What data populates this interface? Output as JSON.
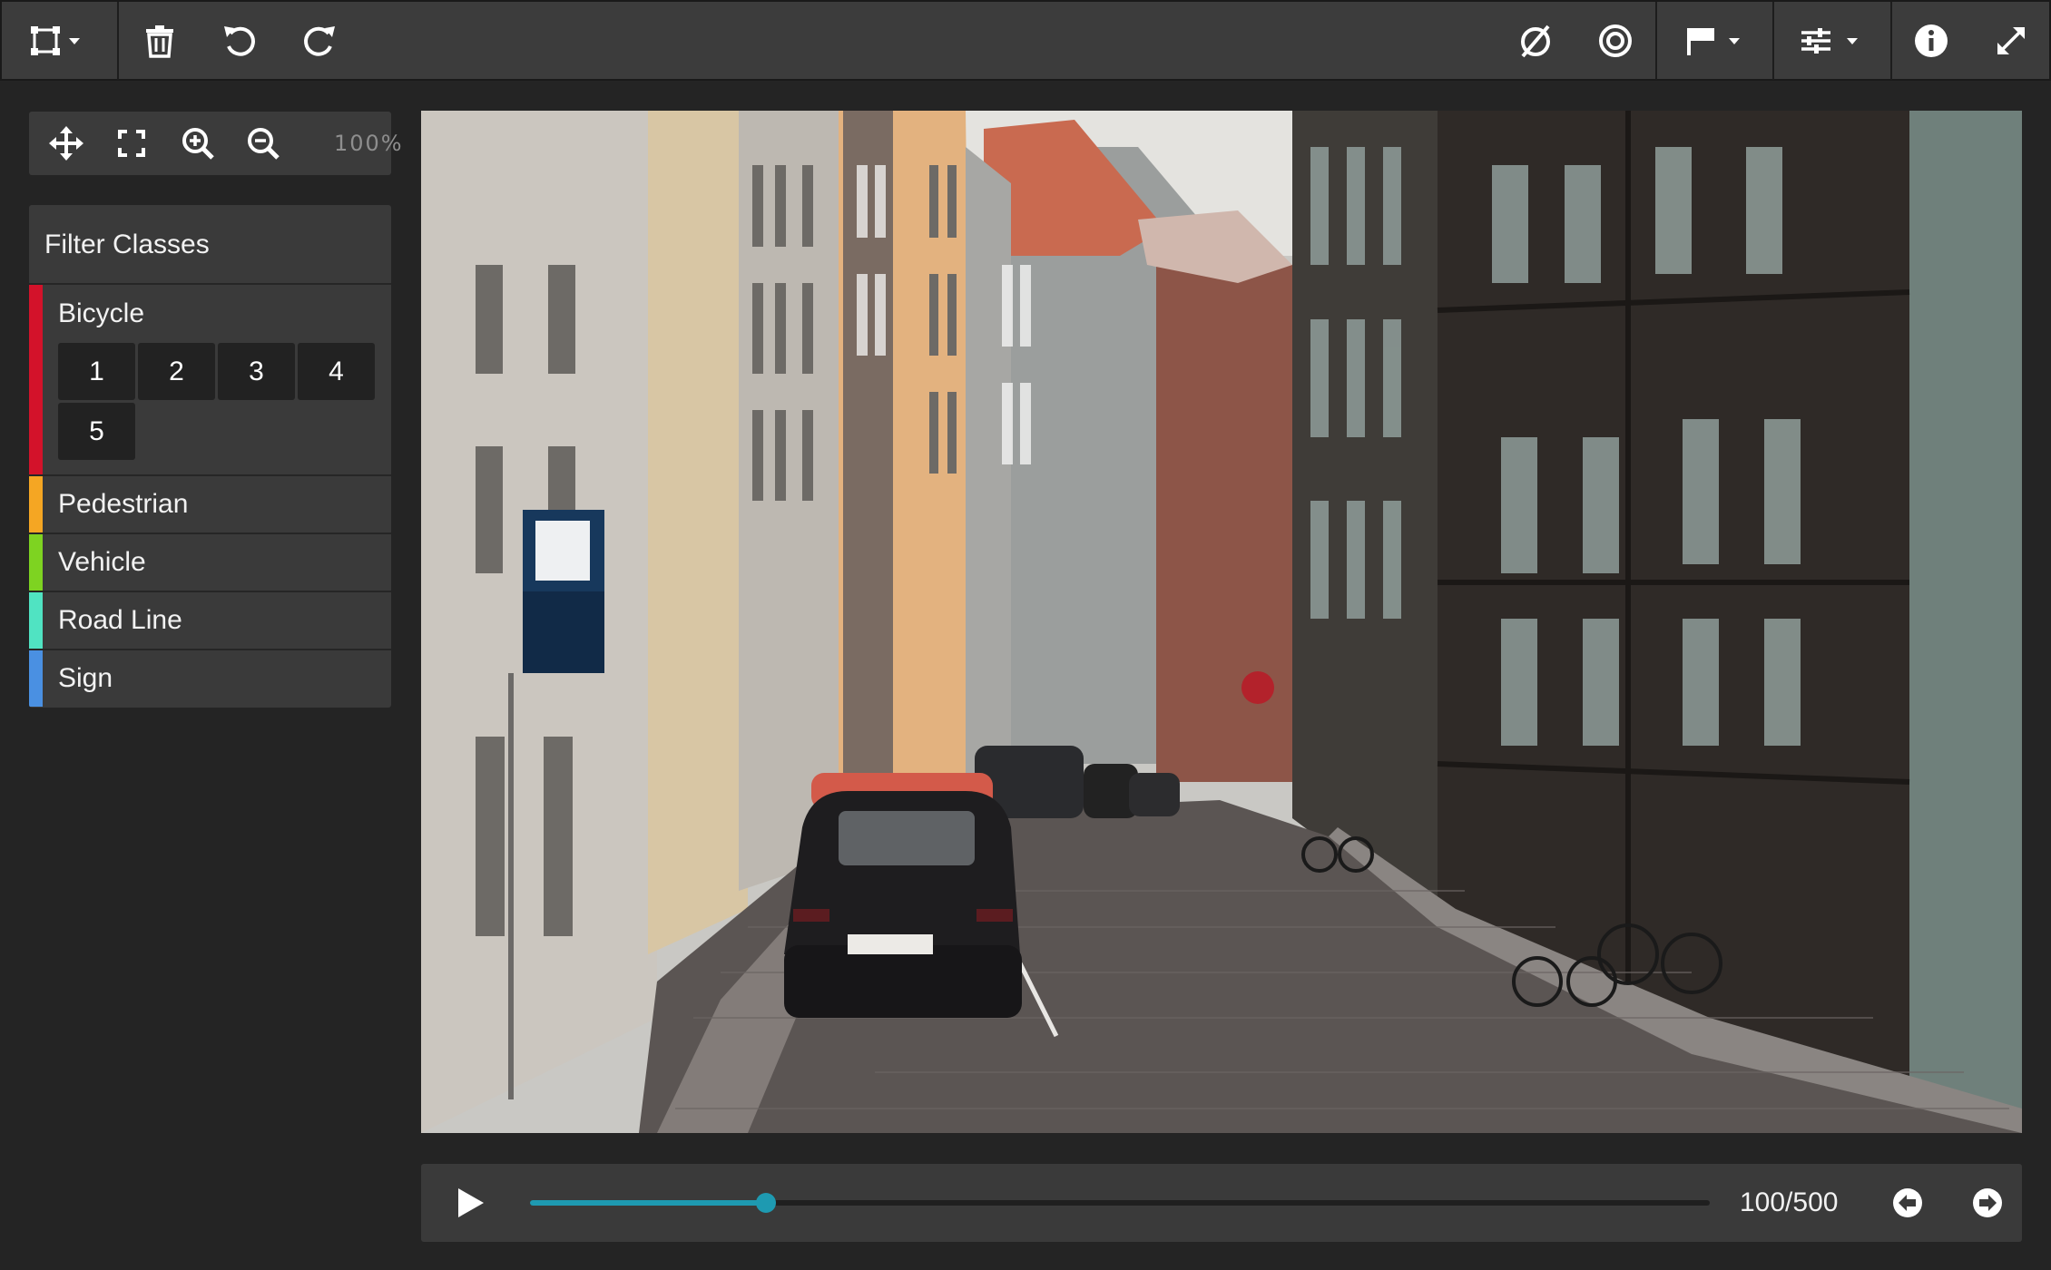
{
  "toolbar": {
    "left_tools": [
      {
        "icon": "bounding-box-icon",
        "dropdown": true
      },
      {
        "icon": "trash-icon"
      },
      {
        "icon": "undo-icon"
      },
      {
        "icon": "redo-icon"
      }
    ],
    "right_tools": [
      {
        "icon": "hide-annotations-icon"
      },
      {
        "icon": "target-icon"
      },
      {
        "icon": "flag-icon",
        "dropdown": true
      },
      {
        "icon": "settings-sliders-icon",
        "dropdown": true
      },
      {
        "icon": "info-icon"
      },
      {
        "icon": "fullscreen-icon"
      }
    ]
  },
  "zoom": {
    "tools": [
      "move-icon",
      "fit-screen-icon",
      "zoom-in-icon",
      "zoom-out-icon"
    ],
    "level": "100%"
  },
  "filter_panel": {
    "title": "Filter Classes",
    "classes": [
      {
        "label": "Bicycle",
        "color": "#d3122a",
        "instances": [
          "1",
          "2",
          "3",
          "4",
          "5"
        ]
      },
      {
        "label": "Pedestrian",
        "color": "#f5a623"
      },
      {
        "label": "Vehicle",
        "color": "#7ed321"
      },
      {
        "label": "Road Line",
        "color": "#50e3c2"
      },
      {
        "label": "Sign",
        "color": "#4a90e2"
      }
    ]
  },
  "playback": {
    "current_frame": 100,
    "total_frames": 500,
    "frame_label": "100/500",
    "accent": "#1e9ab1"
  }
}
